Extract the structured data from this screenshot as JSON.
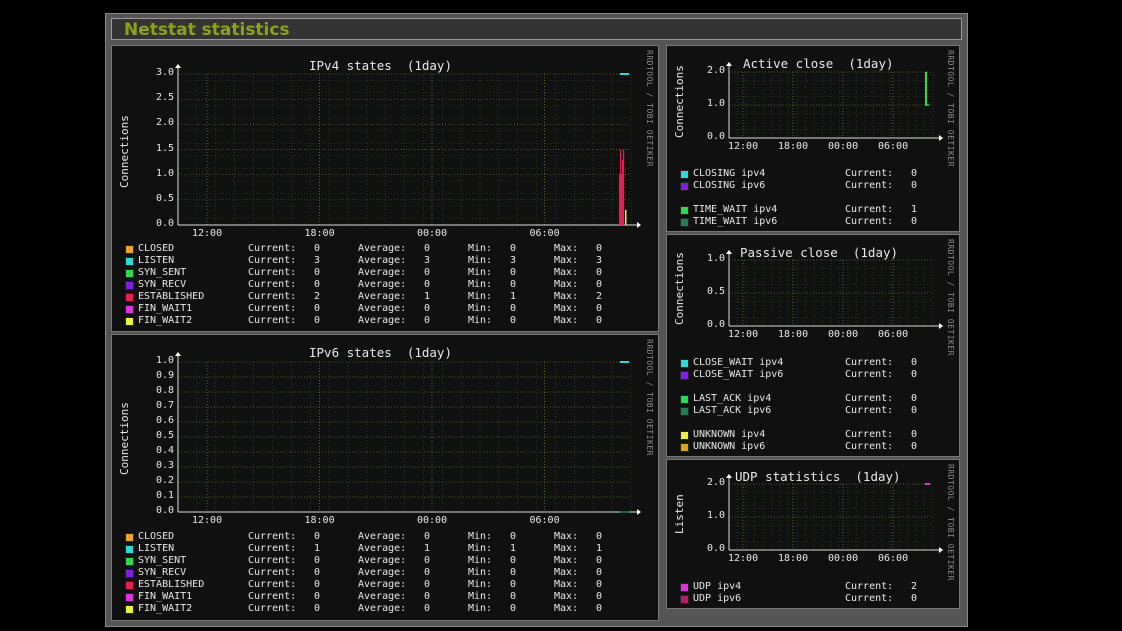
{
  "page": {
    "title": "Netstat statistics"
  },
  "watermark": "RRDTOOL / TOBI OETIKER",
  "x_ticks": [
    "12:00",
    "18:00",
    "00:00",
    "06:00"
  ],
  "legend_labels": {
    "current": "Current:",
    "average": "Average:",
    "min": "Min:",
    "max": "Max:"
  },
  "colors": {
    "background": "#101010",
    "grid_major": "#3a5a1a",
    "grid_minor": "#2a3a20",
    "closed": "#f0a030",
    "listen": "#30d8d8",
    "syn_sent": "#30d850",
    "syn_recv": "#8020e0",
    "established": "#e02050",
    "fin_wait1": "#e030e0",
    "fin_wait2": "#e8f040",
    "ipv4_green": "#30d850",
    "ipv6_green": "#208050",
    "unknown_v6": "#e0a020",
    "udp_v4": "#e030e0",
    "udp_v6": "#b02070",
    "title": "#8fa01a"
  },
  "charts": {
    "ipv4": {
      "title": "IPv4 states  (1day)",
      "ylabel": "Connections",
      "yticks": [
        "3.0",
        "2.5",
        "2.0",
        "1.5",
        "1.0",
        "0.5",
        "0.0"
      ],
      "legend": [
        {
          "name": "CLOSED",
          "color": "#f0a030",
          "current": "0",
          "average": "0",
          "min": "0",
          "max": "0"
        },
        {
          "name": "LISTEN",
          "color": "#30d8d8",
          "current": "3",
          "average": "3",
          "min": "3",
          "max": "3"
        },
        {
          "name": "SYN_SENT",
          "color": "#30d850",
          "current": "0",
          "average": "0",
          "min": "0",
          "max": "0"
        },
        {
          "name": "SYN_RECV",
          "color": "#8020e0",
          "current": "0",
          "average": "0",
          "min": "0",
          "max": "0"
        },
        {
          "name": "ESTABLISHED",
          "color": "#e02050",
          "current": "2",
          "average": "1",
          "min": "1",
          "max": "2"
        },
        {
          "name": "FIN_WAIT1",
          "color": "#e030e0",
          "current": "0",
          "average": "0",
          "min": "0",
          "max": "0"
        },
        {
          "name": "FIN_WAIT2",
          "color": "#e8f040",
          "current": "0",
          "average": "0",
          "min": "0",
          "max": "0"
        }
      ]
    },
    "ipv6": {
      "title": "IPv6 states  (1day)",
      "ylabel": "Connections",
      "yticks": [
        "1.0",
        "0.9",
        "0.8",
        "0.7",
        "0.6",
        "0.5",
        "0.4",
        "0.3",
        "0.2",
        "0.1",
        "0.0"
      ],
      "legend": [
        {
          "name": "CLOSED",
          "color": "#f0a030",
          "current": "0",
          "average": "0",
          "min": "0",
          "max": "0"
        },
        {
          "name": "LISTEN",
          "color": "#30d8d8",
          "current": "1",
          "average": "1",
          "min": "1",
          "max": "1"
        },
        {
          "name": "SYN_SENT",
          "color": "#30d850",
          "current": "0",
          "average": "0",
          "min": "0",
          "max": "0"
        },
        {
          "name": "SYN_RECV",
          "color": "#8020e0",
          "current": "0",
          "average": "0",
          "min": "0",
          "max": "0"
        },
        {
          "name": "ESTABLISHED",
          "color": "#e02050",
          "current": "0",
          "average": "0",
          "min": "0",
          "max": "0"
        },
        {
          "name": "FIN_WAIT1",
          "color": "#e030e0",
          "current": "0",
          "average": "0",
          "min": "0",
          "max": "0"
        },
        {
          "name": "FIN_WAIT2",
          "color": "#e8f040",
          "current": "0",
          "average": "0",
          "min": "0",
          "max": "0"
        }
      ]
    },
    "active_close": {
      "title": "Active close  (1day)",
      "ylabel": "Connections",
      "yticks": [
        "2.0",
        "1.0",
        "0.0"
      ],
      "legend": [
        {
          "name": "CLOSING ipv4",
          "color": "#30d8d8",
          "current": "0"
        },
        {
          "name": "CLOSING ipv6",
          "color": "#8020e0",
          "current": "0"
        },
        {
          "name": "TIME_WAIT ipv4",
          "color": "#30d850",
          "current": "1"
        },
        {
          "name": "TIME_WAIT ipv6",
          "color": "#208050",
          "current": "0"
        }
      ]
    },
    "passive_close": {
      "title": "Passive close  (1day)",
      "ylabel": "Connections",
      "yticks": [
        "1.0",
        "0.5",
        "0.0"
      ],
      "legend": [
        {
          "name": "CLOSE_WAIT ipv4",
          "color": "#30d8d8",
          "current": "0"
        },
        {
          "name": "CLOSE_WAIT ipv6",
          "color": "#8020e0",
          "current": "0"
        },
        {
          "name": "LAST_ACK ipv4",
          "color": "#30d850",
          "current": "0"
        },
        {
          "name": "LAST_ACK ipv6",
          "color": "#208050",
          "current": "0"
        },
        {
          "name": "UNKNOWN ipv4",
          "color": "#e8f040",
          "current": "0"
        },
        {
          "name": "UNKNOWN ipv6",
          "color": "#e0a020",
          "current": "0"
        }
      ]
    },
    "udp": {
      "title": "UDP statistics  (1day)",
      "ylabel": "Listen",
      "yticks": [
        "2.0",
        "1.0",
        "0.0"
      ],
      "legend": [
        {
          "name": "UDP ipv4",
          "color": "#e030e0",
          "current": "2"
        },
        {
          "name": "UDP ipv6",
          "color": "#b02070",
          "current": "0"
        }
      ]
    }
  },
  "chart_data": [
    {
      "type": "area",
      "title": "IPv4 states  (1day)",
      "ylabel": "Connections",
      "ylim": [
        0,
        3
      ],
      "x_tick_labels": [
        "12:00",
        "18:00",
        "00:00",
        "06:00"
      ],
      "series": [
        {
          "name": "LISTEN",
          "values": [
            3
          ]
        },
        {
          "name": "ESTABLISHED",
          "values": [
            1,
            1.5,
            1,
            1.3,
            1.5
          ]
        },
        {
          "name": "FIN_WAIT2",
          "values": [
            0.3
          ]
        }
      ]
    },
    {
      "type": "area",
      "title": "IPv6 states  (1day)",
      "ylabel": "Connections",
      "ylim": [
        0,
        1
      ],
      "x_tick_labels": [
        "12:00",
        "18:00",
        "00:00",
        "06:00"
      ],
      "series": [
        {
          "name": "LISTEN",
          "values": [
            1
          ]
        }
      ]
    },
    {
      "type": "area",
      "title": "Active close  (1day)",
      "ylabel": "Connections",
      "ylim": [
        0,
        2
      ],
      "x_tick_labels": [
        "12:00",
        "18:00",
        "00:00",
        "06:00"
      ],
      "series": [
        {
          "name": "TIME_WAIT ipv4",
          "values": [
            1,
            2,
            1,
            1
          ]
        }
      ]
    },
    {
      "type": "area",
      "title": "Passive close  (1day)",
      "ylabel": "Connections",
      "ylim": [
        0,
        1
      ],
      "x_tick_labels": [
        "12:00",
        "18:00",
        "00:00",
        "06:00"
      ],
      "series": []
    },
    {
      "type": "area",
      "title": "UDP statistics  (1day)",
      "ylabel": "Listen",
      "ylim": [
        0,
        2
      ],
      "x_tick_labels": [
        "12:00",
        "18:00",
        "00:00",
        "06:00"
      ],
      "series": [
        {
          "name": "UDP ipv4",
          "values": [
            2
          ]
        }
      ]
    }
  ]
}
